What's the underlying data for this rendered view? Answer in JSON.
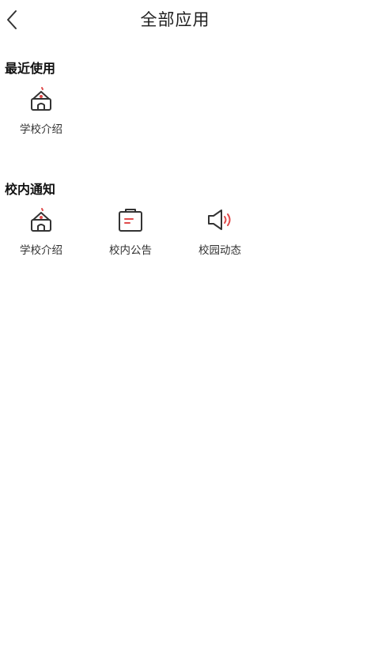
{
  "header": {
    "title": "全部应用",
    "back_icon": "chevron-left-icon"
  },
  "sections": [
    {
      "title": "最近使用",
      "items": [
        {
          "label": "学校介绍",
          "icon": "school-building-icon"
        }
      ]
    },
    {
      "title": "校内通知",
      "items": [
        {
          "label": "学校介绍",
          "icon": "school-building-icon"
        },
        {
          "label": "校内公告",
          "icon": "notice-board-icon"
        },
        {
          "label": "校园动态",
          "icon": "speaker-icon"
        }
      ]
    }
  ],
  "colors": {
    "icon_stroke": "#333333",
    "accent": "#e04a4a",
    "background": "#ffffff"
  }
}
